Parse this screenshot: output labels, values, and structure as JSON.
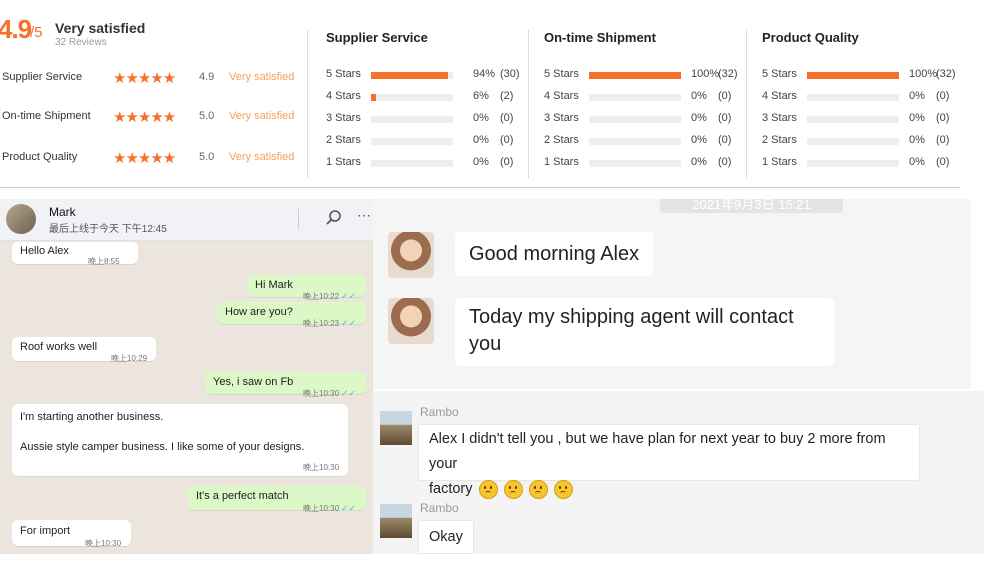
{
  "review": {
    "score": "4.9",
    "score_suffix": "/5",
    "summary": "Very satisfied",
    "reviews_count": "32 Reviews",
    "summary_rows": [
      {
        "label": "Supplier Service",
        "stars": "★★★★★",
        "value": "4.9",
        "text": "Very satisfied"
      },
      {
        "label": "On-time Shipment",
        "stars": "★★★★★",
        "value": "5.0",
        "text": "Very satisfied"
      },
      {
        "label": "Product Quality",
        "stars": "★★★★★",
        "value": "5.0",
        "text": "Very satisfied"
      }
    ],
    "categories": [
      {
        "title": "Supplier Service",
        "rows": [
          {
            "label": "5 Stars",
            "fraction": 0.94,
            "percent": "94%",
            "count": "(30)"
          },
          {
            "label": "4 Stars",
            "fraction": 0.06,
            "percent": "6%",
            "count": "(2)"
          },
          {
            "label": "3 Stars",
            "fraction": 0,
            "percent": "0%",
            "count": "(0)"
          },
          {
            "label": "2 Stars",
            "fraction": 0,
            "percent": "0%",
            "count": "(0)"
          },
          {
            "label": "1 Stars",
            "fraction": 0,
            "percent": "0%",
            "count": "(0)"
          }
        ]
      },
      {
        "title": "On-time Shipment",
        "rows": [
          {
            "label": "5 Stars",
            "fraction": 1.0,
            "percent": "100%",
            "count": "(32)"
          },
          {
            "label": "4 Stars",
            "fraction": 0,
            "percent": "0%",
            "count": "(0)"
          },
          {
            "label": "3 Stars",
            "fraction": 0,
            "percent": "0%",
            "count": "(0)"
          },
          {
            "label": "2 Stars",
            "fraction": 0,
            "percent": "0%",
            "count": "(0)"
          },
          {
            "label": "1 Stars",
            "fraction": 0,
            "percent": "0%",
            "count": "(0)"
          }
        ]
      },
      {
        "title": "Product Quality",
        "rows": [
          {
            "label": "5 Stars",
            "fraction": 1.0,
            "percent": "100%",
            "count": "(32)"
          },
          {
            "label": "4 Stars",
            "fraction": 0,
            "percent": "0%",
            "count": "(0)"
          },
          {
            "label": "3 Stars",
            "fraction": 0,
            "percent": "0%",
            "count": "(0)"
          },
          {
            "label": "2 Stars",
            "fraction": 0,
            "percent": "0%",
            "count": "(0)"
          },
          {
            "label": "1 Stars",
            "fraction": 0,
            "percent": "0%",
            "count": "(0)"
          }
        ]
      }
    ]
  },
  "whatsapp": {
    "contact_name": "Mark",
    "status": "最后上线于今天 下午12:45",
    "menu_icon": "⋯",
    "messages": [
      {
        "dir": "in",
        "text": "Hello Alex",
        "time": "晚上8:55"
      },
      {
        "dir": "out",
        "text": "Hi Mark",
        "time": "晚上10:22"
      },
      {
        "dir": "out",
        "text": "How are you?",
        "time": "晚上10:23"
      },
      {
        "dir": "in",
        "text": "Roof works well",
        "time": "晚上10:29"
      },
      {
        "dir": "out",
        "text": "Yes, i saw on Fb",
        "time": "晚上10:30"
      },
      {
        "dir": "in",
        "line1": "I'm starting another business.",
        "line2": "Aussie style camper business. I like some of your designs.",
        "time": "晚上10:30"
      },
      {
        "dir": "out",
        "text": "It's a perfect match",
        "time": "晚上10:30"
      },
      {
        "dir": "in",
        "text": "For import",
        "time": "晚上10:30"
      }
    ],
    "tick": "✓✓"
  },
  "chat1": {
    "date_stamp": "2021年9月3日 15:21",
    "messages": [
      {
        "text": "Good morning Alex"
      },
      {
        "line1": "Today my shipping agent will contact",
        "line2": "you"
      }
    ]
  },
  "chat2": {
    "messages": [
      {
        "sender": "Rambo",
        "line1": "Alex I didn't tell you , but we have plan for next year to buy 2 more from your",
        "line2": "factory"
      },
      {
        "sender": "Rambo",
        "text": "Okay"
      }
    ]
  },
  "colors": {
    "accent": "#f5702b",
    "whatsapp_out": "#dcf8c6",
    "whatsapp_bg": "#ece5dd"
  }
}
